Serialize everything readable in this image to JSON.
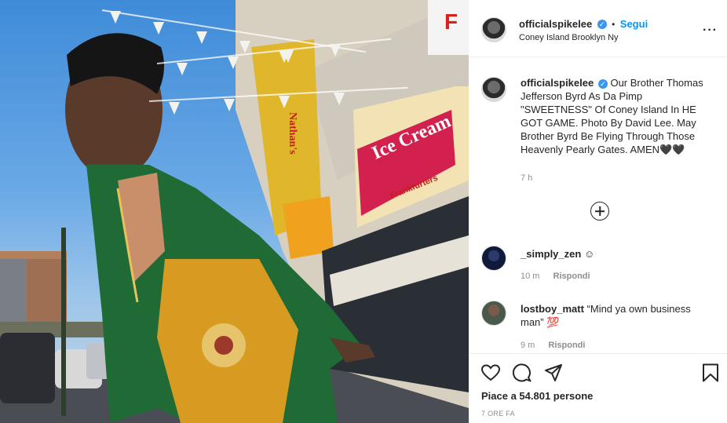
{
  "post": {
    "image_alt": "Thomas Jefferson Byrd at Coney Island",
    "sign_words": [
      "Nathan's",
      "Ice Cream",
      "Frankfurters",
      "F"
    ],
    "header": {
      "username": "officialspikelee",
      "verified_mark": "✓",
      "separator": "•",
      "follow_label": "Segui",
      "location": "Coney Island Brooklyn Ny",
      "more_glyph": "···"
    },
    "caption": {
      "username": "officialspikelee",
      "text": "Our Brother Thomas Jefferson Byrd As Da Pimp \"SWEETNESS\" Of Coney Island In HE GOT GAME. Photo By David Lee. May Brother Byrd Be Flying Through Those Heavenly Pearly Gates. AMEN🖤🖤",
      "time": "7 h"
    },
    "comments": [
      {
        "username": "_simply_zen",
        "text": "☺",
        "time": "10 m",
        "reply_label": "Rispondi"
      },
      {
        "username": "lostboy_matt",
        "text": "“Mind ya own business man” 💯",
        "time": "9 m",
        "reply_label": "Rispondi"
      }
    ],
    "likes_text": "Piace a 54.801 persone",
    "timestamp": "7 ORE FA"
  },
  "colors": {
    "accent": "#0095f6",
    "verified": "#3897f0",
    "muted": "#8e8e8e",
    "text": "#262626"
  }
}
